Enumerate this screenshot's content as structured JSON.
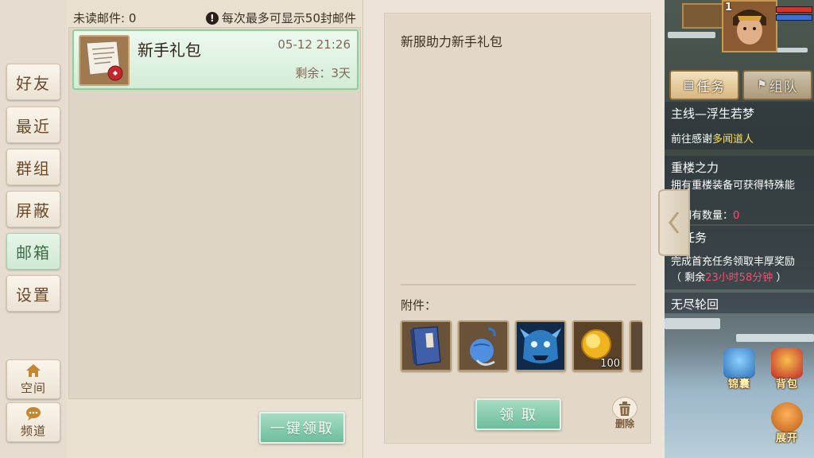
{
  "sidebar": {
    "items": [
      {
        "label": "好友"
      },
      {
        "label": "最近"
      },
      {
        "label": "群组"
      },
      {
        "label": "屏蔽"
      },
      {
        "label": "邮箱",
        "active": true
      },
      {
        "label": "设置"
      }
    ],
    "bottom": [
      {
        "label": "空间",
        "icon": "house-icon"
      },
      {
        "label": "频道",
        "icon": "chat-bubble-icon"
      }
    ]
  },
  "mail_list": {
    "unread_text": "未读邮件: 0",
    "notice": "每次最多可显示50封邮件",
    "items": [
      {
        "title": "新手礼包",
        "date": "05-12 21:26",
        "remaining": "剩余：3天",
        "icon": "letter-icon"
      }
    ],
    "claim_all_label": "一键领取"
  },
  "mail_detail": {
    "body": "新服助力新手礼包",
    "attachments_label": "附件：",
    "attachments": [
      {
        "icon": "book-icon",
        "qty": ""
      },
      {
        "icon": "blue-pouch-icon",
        "qty": ""
      },
      {
        "icon": "blue-beast-icon",
        "qty": ""
      },
      {
        "icon": "gold-orb-icon",
        "qty": "100"
      }
    ],
    "claim_label": "领 取",
    "delete_label": "删除"
  },
  "game_hud": {
    "level": "1",
    "tabs": {
      "quest": "任务",
      "team": "组队"
    },
    "quests": [
      {
        "title": "主线—浮生若梦",
        "desc_prefix": "前往感谢",
        "desc_highlight": "多闻道人"
      },
      {
        "title": "重楼之力",
        "desc": "拥有重楼装备可获得特殊能",
        "desc2_prefix": "前拥有数量：",
        "desc2_value": "0"
      },
      {
        "title": "充任务",
        "desc": "完成首充任务领取丰厚奖励",
        "desc2_prefix": "（ 剩余",
        "desc2_value": "23小时58分钟",
        "desc2_suffix": " ）"
      },
      {
        "title": "无尽轮回"
      }
    ],
    "corner_buttons": {
      "left": "锦囊",
      "right": "背包",
      "expand": "展开"
    },
    "colors": {
      "highlight_yellow": "#ffe14a",
      "highlight_red": "#ff4a6e",
      "accent_green": "#6dbd9d"
    }
  }
}
